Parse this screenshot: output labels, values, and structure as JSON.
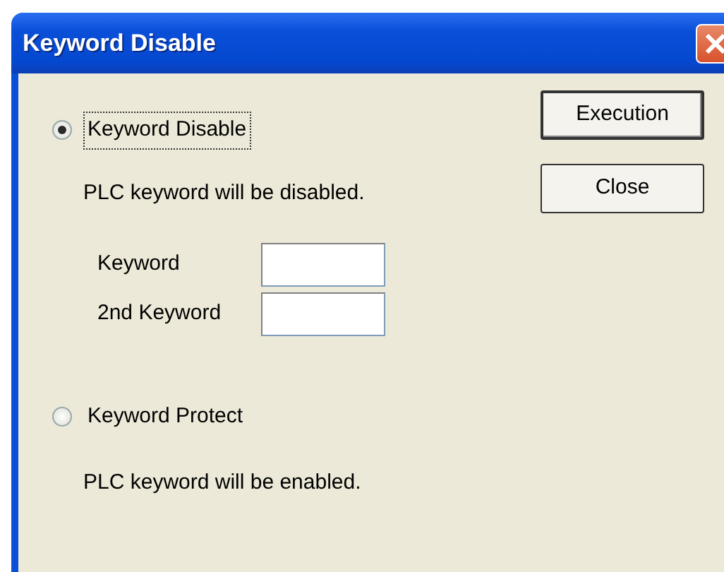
{
  "window": {
    "title": "Keyword Disable"
  },
  "options": [
    {
      "label": "Keyword Disable",
      "selected": true,
      "focused": true,
      "description": "PLC keyword will be disabled.",
      "fields": [
        {
          "label": "Keyword"
        },
        {
          "label": "2nd Keyword"
        }
      ]
    },
    {
      "label": "Keyword Protect",
      "selected": false,
      "focused": false,
      "description": "PLC keyword will be enabled."
    }
  ],
  "buttons": [
    {
      "label": "Execution",
      "default": true
    },
    {
      "label": "Close",
      "default": false
    }
  ]
}
